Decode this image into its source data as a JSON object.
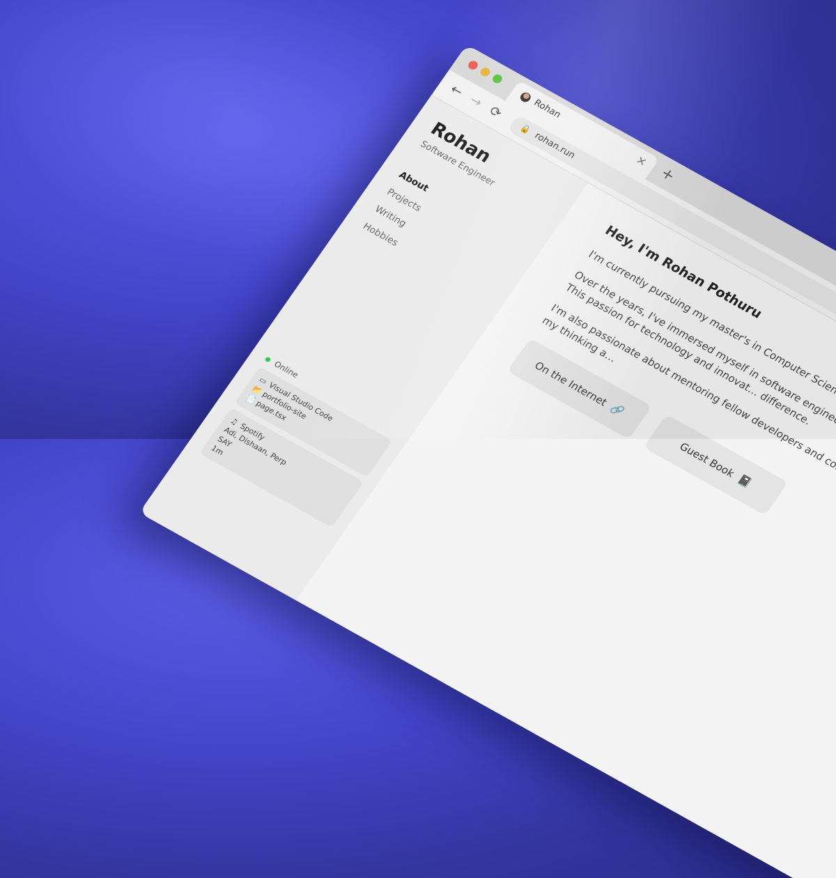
{
  "browser": {
    "tab_title": "Rohan",
    "tab_close": "×",
    "new_tab": "+",
    "url": "rohan.run",
    "back": "←",
    "forward": "→",
    "reload": "⟳"
  },
  "sidebar": {
    "name": "Rohan",
    "role": "Software Engineer",
    "nav": [
      "About",
      "Projects",
      "Writing",
      "Hobbies"
    ]
  },
  "status": {
    "online": "Online",
    "vscode": {
      "app": "Visual Studio Code",
      "project": "portfolio-site",
      "file": "page.tsx"
    },
    "spotify": {
      "app": "Spotify",
      "artists": "Adi, Dishaan, Perp",
      "track": "SAY",
      "time": "1m"
    }
  },
  "main": {
    "greeting": "Hey, I'm Rohan Pothuru",
    "p1": "I'm currently pursuing my master's in Computer Science at the University … Development Engineer at Ixigo.",
    "p2": "Over the years, I've immersed myself in software engineering—building side … how things work under the hood. This passion for technology and innovat… difference.",
    "p3": "I'm also passionate about mentoring fellow developers and cont… general intelligence (AGI) continuously shapes my thinking a…",
    "links": [
      {
        "label": "On the Internet",
        "icon": "🔗"
      },
      {
        "label": "Guest Book",
        "icon": "📓"
      }
    ]
  },
  "colors": {
    "background": "#4446cc",
    "online": "#2ecc4d",
    "close_dot": "#ec5f57",
    "minimize_dot": "#e8b33a",
    "maximize_dot": "#5bc23f"
  }
}
